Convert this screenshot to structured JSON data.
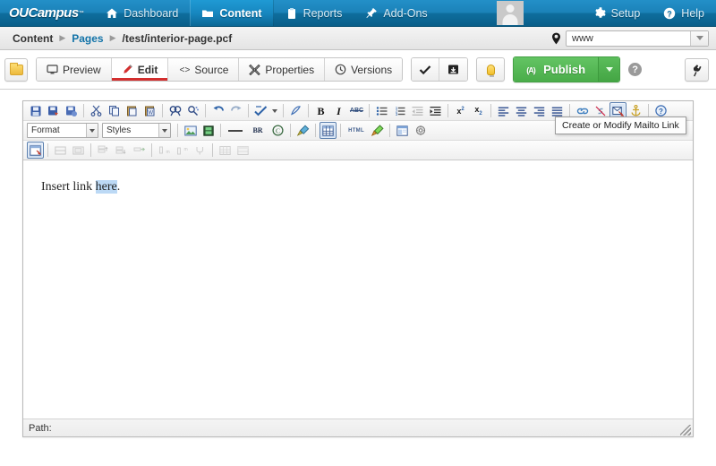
{
  "topnav": {
    "logo": "OUCampus",
    "logo_tm": "™",
    "items": [
      {
        "label": "Dashboard",
        "icon": "home-icon",
        "active": false
      },
      {
        "label": "Content",
        "icon": "folder-icon",
        "active": true
      },
      {
        "label": "Reports",
        "icon": "clipboard-icon",
        "active": false
      },
      {
        "label": "Add-Ons",
        "icon": "pushpin-icon",
        "active": false
      }
    ],
    "avatar": "user-avatar",
    "right_items": [
      {
        "label": "Setup",
        "icon": "gear-icon"
      },
      {
        "label": "Help",
        "icon": "question-circle-icon"
      }
    ]
  },
  "breadcrumb": {
    "items": [
      {
        "label": "Content",
        "type": "plain"
      },
      {
        "label": "Pages",
        "type": "link"
      },
      {
        "label": "/test/interior-page.pcf",
        "type": "plain"
      }
    ],
    "separator": "▶"
  },
  "site_picker": {
    "icon": "location-pin-icon",
    "value": "www",
    "options": [
      "www"
    ]
  },
  "actionbar": {
    "folder_button": "folder-button",
    "tabs": [
      {
        "label": "Preview",
        "icon": "monitor-icon",
        "selected": false
      },
      {
        "label": "Edit",
        "icon": "pencil-icon",
        "selected": true
      },
      {
        "label": "Source",
        "icon": "code-icon",
        "selected": false
      },
      {
        "label": "Properties",
        "icon": "wrench-icon",
        "selected": false
      },
      {
        "label": "Versions",
        "icon": "clock-history-icon",
        "selected": false
      }
    ],
    "save_check": "check-icon",
    "save_disk": "save-icon",
    "bulb": "lightbulb-icon",
    "publish_label": "Publish",
    "publish_icon": "broadcast-icon",
    "publish_caret": "caret-down-icon",
    "help_badge": "?",
    "plug": "plug-icon",
    "publish_color": "#4aad4a"
  },
  "editor": {
    "toolbar_row1": [
      {
        "name": "save-icon",
        "glyph": "💾",
        "sep_after": false
      },
      {
        "name": "save-as-icon",
        "glyph": "💾",
        "sep_after": false
      },
      {
        "name": "save-version-icon",
        "glyph": "💾",
        "sep_after": true
      },
      {
        "name": "cut-icon",
        "glyph": "✂",
        "sep_after": false
      },
      {
        "name": "copy-icon",
        "glyph": "⧉",
        "sep_after": false
      },
      {
        "name": "paste-icon",
        "glyph": "📋",
        "sep_after": false
      },
      {
        "name": "paste-from-word-icon",
        "glyph": "W",
        "sep_after": true
      },
      {
        "name": "find-icon",
        "glyph": "🔍",
        "sep_after": false
      },
      {
        "name": "replace-icon",
        "glyph": "🔎",
        "sep_after": true
      },
      {
        "name": "undo-icon",
        "glyph": "↶",
        "sep_after": false
      },
      {
        "name": "redo-icon",
        "glyph": "↷",
        "sep_after": true
      },
      {
        "name": "spellcheck-icon",
        "glyph": "✓",
        "sep_after": true
      },
      {
        "name": "remove-format-icon",
        "glyph": "⌀",
        "sep_after": true
      },
      {
        "name": "bold-icon",
        "glyph": "B",
        "sep_after": false
      },
      {
        "name": "italic-icon",
        "glyph": "I",
        "sep_after": false
      },
      {
        "name": "strikethrough-icon",
        "glyph": "ABC",
        "sep_after": true
      },
      {
        "name": "bullet-list-icon",
        "glyph": "•≡",
        "sep_after": false
      },
      {
        "name": "numbered-list-icon",
        "glyph": "1≡",
        "sep_after": false
      },
      {
        "name": "outdent-icon",
        "glyph": "⇤",
        "sep_after": false
      },
      {
        "name": "indent-icon",
        "glyph": "⇥",
        "sep_after": true
      },
      {
        "name": "superscript-icon",
        "glyph": "x²",
        "sep_after": false
      },
      {
        "name": "subscript-icon",
        "glyph": "x₂",
        "sep_after": true
      },
      {
        "name": "align-left-icon",
        "glyph": "≡",
        "sep_after": false
      },
      {
        "name": "align-center-icon",
        "glyph": "≡",
        "sep_after": false
      },
      {
        "name": "align-right-icon",
        "glyph": "≡",
        "sep_after": false
      },
      {
        "name": "justify-icon",
        "glyph": "≡",
        "sep_after": true
      },
      {
        "name": "insert-link-icon",
        "glyph": "🔗",
        "sep_after": false
      },
      {
        "name": "unlink-icon",
        "glyph": "⛓",
        "sep_after": false
      },
      {
        "name": "mailto-link-icon",
        "glyph": "✉",
        "sep_after": false,
        "active": true
      },
      {
        "name": "anchor-icon",
        "glyph": "⚓",
        "sep_after": true
      },
      {
        "name": "about-icon",
        "glyph": "?",
        "sep_after": false
      }
    ],
    "format_select": {
      "label": "Format",
      "options": [
        "Format"
      ]
    },
    "styles_select": {
      "label": "Styles",
      "options": [
        "Styles"
      ]
    },
    "toolbar_row2": [
      {
        "name": "insert-image-icon",
        "glyph": "🖼"
      },
      {
        "name": "insert-media-icon",
        "glyph": "🎞"
      },
      {
        "name": "horizontal-rule-icon",
        "glyph": "—"
      },
      {
        "name": "line-break-icon",
        "glyph": "BR"
      },
      {
        "name": "special-character-icon",
        "glyph": "©"
      },
      {
        "name": "clean-html-icon",
        "glyph": "🧹"
      },
      {
        "name": "insert-table-icon",
        "glyph": "▦",
        "active": true
      },
      {
        "name": "html-source-icon",
        "glyph": "HTML"
      },
      {
        "name": "insert-snippet-icon",
        "glyph": "🖌"
      },
      {
        "name": "insert-asset-icon",
        "glyph": "▤"
      },
      {
        "name": "insert-component-icon",
        "glyph": "⚙"
      }
    ],
    "toolbar_row3": [
      {
        "name": "table-properties-icon",
        "glyph": "▤",
        "active": true
      },
      {
        "name": "delete-table-icon",
        "glyph": "⊟",
        "dis": true
      },
      {
        "name": "cell-properties-icon",
        "glyph": "⊡",
        "dis": true
      },
      {
        "name": "insert-row-before-icon",
        "glyph": "⤒",
        "dis": true
      },
      {
        "name": "insert-row-after-icon",
        "glyph": "⤓",
        "dis": true
      },
      {
        "name": "delete-row-icon",
        "glyph": "⇥",
        "dis": true
      },
      {
        "name": "insert-column-before-icon",
        "glyph": "m",
        "dis": true
      },
      {
        "name": "insert-column-after-icon",
        "glyph": "m",
        "dis": true
      },
      {
        "name": "delete-column-icon",
        "glyph": "Ψ",
        "dis": true
      },
      {
        "name": "split-cell-icon",
        "glyph": "▦",
        "dis": true
      },
      {
        "name": "merge-cells-icon",
        "glyph": "▣",
        "dis": true
      }
    ],
    "content": {
      "before": "Insert link ",
      "selected": "here",
      "after": "."
    },
    "path_label": "Path:",
    "path_value": ""
  },
  "tooltip": {
    "text": "Create or Modify Mailto Link"
  }
}
